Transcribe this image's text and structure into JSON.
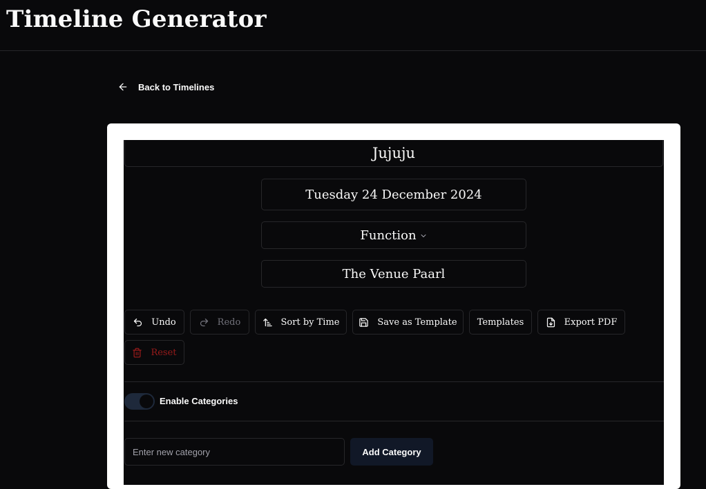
{
  "app": {
    "title": "Timeline Generator"
  },
  "nav": {
    "back_label": "Back to Timelines"
  },
  "timeline": {
    "name": "Jujuju",
    "date": "Tuesday 24 December 2024",
    "event_type": "Function",
    "venue": "The Venue Paarl"
  },
  "toolbar": {
    "undo": "Undo",
    "redo": "Redo",
    "sort": "Sort by Time",
    "save_template": "Save as Template",
    "templates": "Templates",
    "export_pdf": "Export PDF",
    "reset": "Reset"
  },
  "categories": {
    "toggle_label": "Enable Categories",
    "toggle_on": true,
    "input_placeholder": "Enter new category",
    "input_value": "",
    "add_label": "Add Category"
  },
  "colors": {
    "background": "#09090b",
    "border": "#27272a",
    "card": "#ffffff",
    "danger": "#991b1b",
    "muted": "#71717a",
    "toggle_track": "#1e293b"
  },
  "icons": {
    "back": "arrow-left-icon",
    "event_type": "chevron-down-icon",
    "undo": "undo-icon",
    "redo": "redo-icon",
    "sort": "sort-ascending-icon",
    "save_template": "save-icon",
    "export_pdf": "file-download-icon",
    "reset": "trash-icon"
  }
}
